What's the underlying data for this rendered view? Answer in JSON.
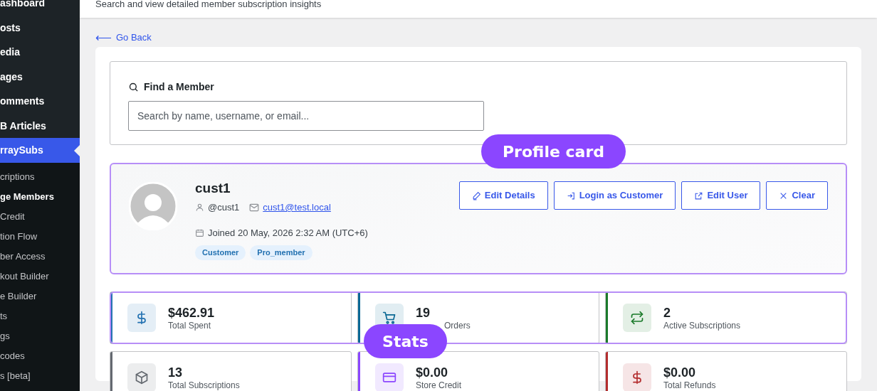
{
  "sidebar": {
    "items": [
      {
        "label": "ashboard",
        "selected": false
      },
      {
        "label": "osts",
        "selected": false
      },
      {
        "label": "edia",
        "selected": false
      },
      {
        "label": "ages",
        "selected": false
      },
      {
        "label": "omments",
        "selected": false
      },
      {
        "label": "B Articles",
        "selected": false
      },
      {
        "label": "rraySubs",
        "selected": true,
        "children": [
          {
            "label": "criptions",
            "selected": false
          },
          {
            "label": "ge Members",
            "selected": true
          },
          {
            "label": "Credit",
            "selected": false
          },
          {
            "label": "tion Flow",
            "selected": false
          },
          {
            "label": "ber Access",
            "selected": false
          },
          {
            "label": "kout Builder",
            "selected": false
          },
          {
            "label": "e Builder",
            "selected": false
          },
          {
            "label": "ts",
            "selected": false
          },
          {
            "label": "gs",
            "selected": false
          },
          {
            "label": "codes",
            "selected": false
          },
          {
            "label": "s [beta]",
            "selected": false
          }
        ]
      }
    ]
  },
  "header": {
    "subtitle": "Search and view detailed member subscription insights"
  },
  "back_link": {
    "arrow": "⟵",
    "label": "Go Back"
  },
  "search": {
    "title": "Find a Member",
    "placeholder": "Search by name, username, or email..."
  },
  "profile": {
    "name": "cust1",
    "username": "@cust1",
    "email": "cust1@test.local",
    "joined": "Joined 20 May, 2026 2:32 AM (UTC+6)",
    "tags": [
      "Customer",
      "Pro_member"
    ],
    "buttons": [
      {
        "kind": "edit",
        "label": "Edit Details"
      },
      {
        "kind": "login",
        "label": "Login as Customer"
      },
      {
        "kind": "external",
        "label": "Edit User"
      },
      {
        "kind": "close",
        "label": "Clear"
      }
    ]
  },
  "stats": [
    {
      "kind": "dollar",
      "value": "$462.91",
      "label": "Total Spent",
      "color": "#2271b1"
    },
    {
      "kind": "cart",
      "value": "19",
      "label": "Orders",
      "color": "#0a6894"
    },
    {
      "kind": "repeat",
      "value": "2",
      "label": "Active Subscriptions",
      "color": "#1a7a2a"
    },
    {
      "kind": "box",
      "value": "13",
      "label": "Total Subscriptions",
      "color": "#646970"
    },
    {
      "kind": "card",
      "value": "$0.00",
      "label": "Store Credit",
      "color": "#8b46ff"
    },
    {
      "kind": "dollar",
      "value": "$0.00",
      "label": "Total Refunds",
      "color": "#b32d2e"
    }
  ],
  "annotations": [
    {
      "label": "Profile card"
    },
    {
      "label": "Stats"
    }
  ]
}
